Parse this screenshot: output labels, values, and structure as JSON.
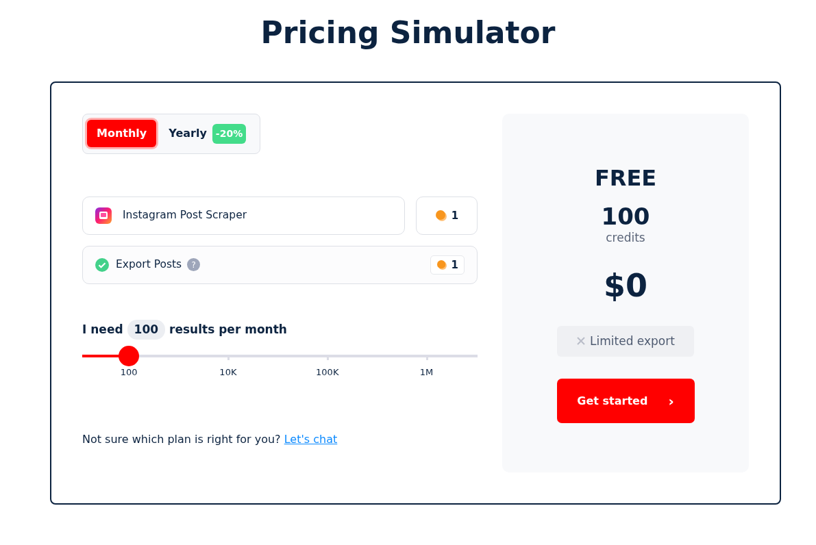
{
  "title": "Pricing Simulator",
  "billing_tabs": [
    {
      "label": "Monthly",
      "selected": true
    },
    {
      "label": "Yearly",
      "selected": false,
      "badge": "-20%"
    }
  ],
  "actor": {
    "name": "Instagram Post Scraper",
    "cost": "1"
  },
  "features": [
    {
      "label": "Export Posts",
      "checked": true,
      "help": "?",
      "cost": "1"
    }
  ],
  "volume": {
    "prefix": "I need",
    "value": "100",
    "suffix": "results per month",
    "level": 0.118,
    "ticks": [
      "100",
      "10K",
      "100K",
      "1M"
    ]
  },
  "help_text": {
    "text": "Not sure which plan is right for you?",
    "link": "Let's chat"
  },
  "plan": {
    "name": "FREE",
    "credits": "100",
    "credits_label": "credits",
    "price": "$0",
    "limits": [
      {
        "label": "Limited export",
        "included": false
      }
    ],
    "cta": "Get started",
    "cta_icon": "›"
  }
}
